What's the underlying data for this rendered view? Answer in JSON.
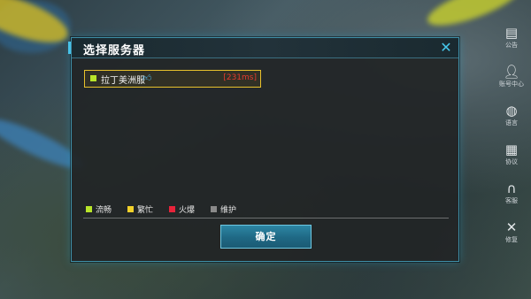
{
  "dialog": {
    "title": "选择服务器",
    "close_icon": "close-icon"
  },
  "servers": [
    {
      "name": "拉丁美洲服",
      "ping": "[231ms]",
      "status_color": "#b8e52a",
      "badge_icon": "thumbs-up-icon",
      "selected": true
    }
  ],
  "legend": [
    {
      "label": "流畅",
      "color": "#b8e52a"
    },
    {
      "label": "繁忙",
      "color": "#f2d12a"
    },
    {
      "label": "火爆",
      "color": "#e8233a"
    },
    {
      "label": "维护",
      "color": "#8a8a8a"
    }
  ],
  "confirm_label": "确定",
  "side_menu": [
    {
      "label": "公告",
      "icon": "announcement-icon"
    },
    {
      "label": "账号中心",
      "icon": "user-icon"
    },
    {
      "label": "语言",
      "icon": "globe-icon"
    },
    {
      "label": "协议",
      "icon": "document-icon"
    },
    {
      "label": "客服",
      "icon": "headset-icon"
    },
    {
      "label": "修复",
      "icon": "wrench-icon"
    }
  ],
  "colors": {
    "accent": "#46c6ea",
    "selected_border": "#e8c12c",
    "ping": "#e23b2e"
  }
}
